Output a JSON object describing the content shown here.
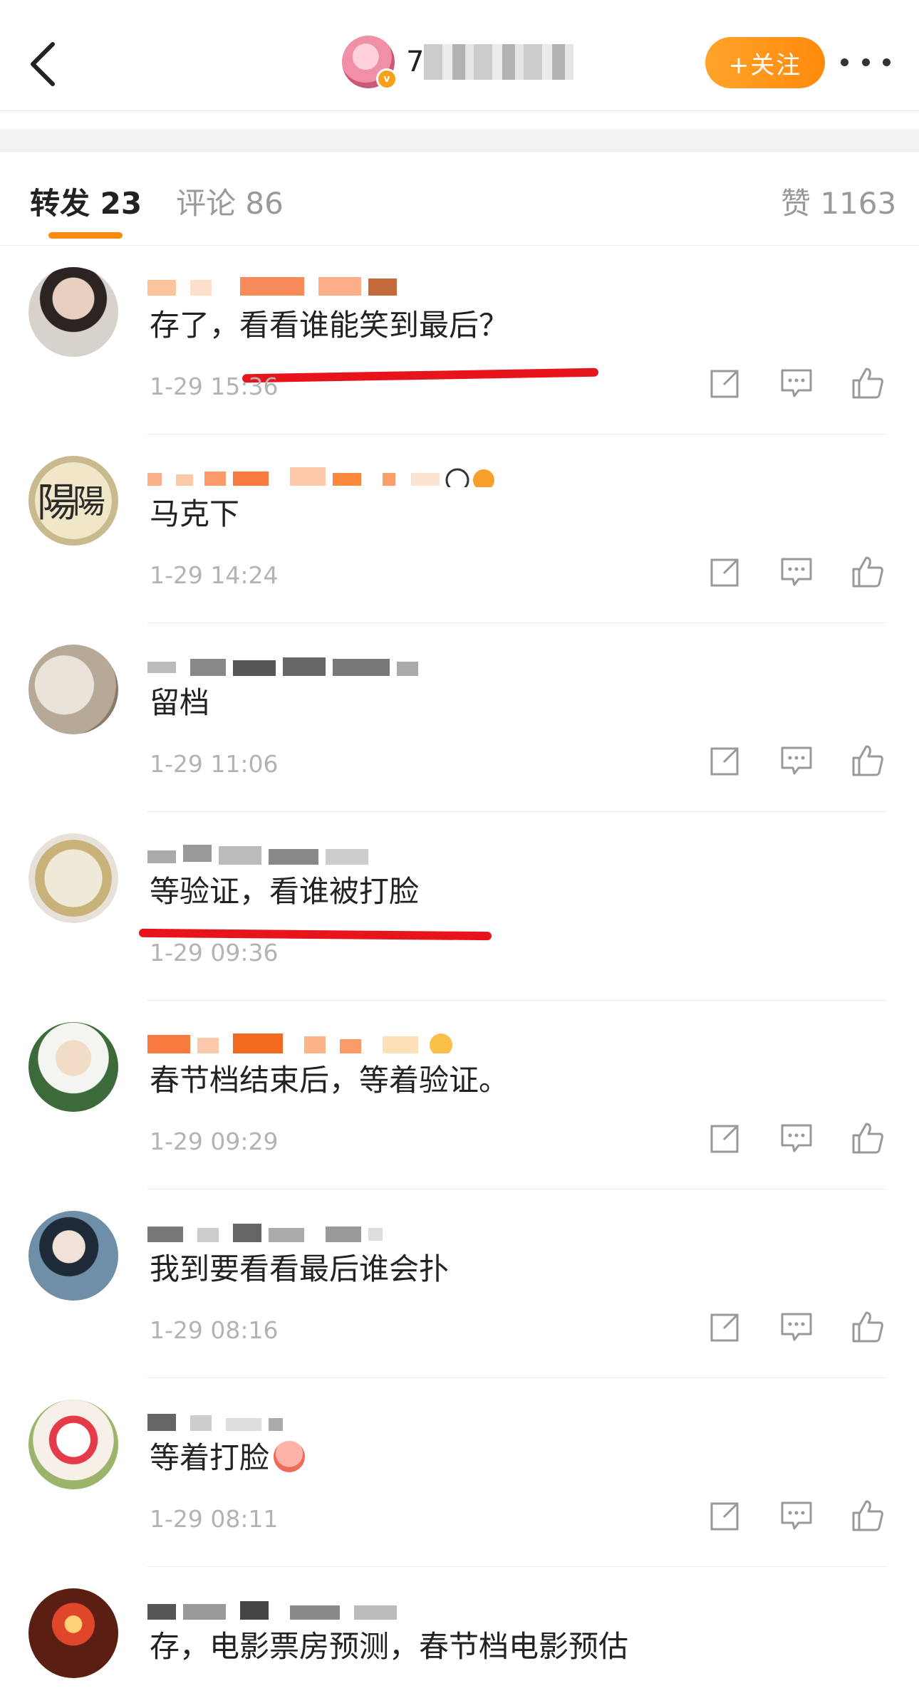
{
  "header": {
    "back_label": "",
    "name": "7",
    "follow_label": "+关注"
  },
  "tabs": [
    {
      "label": "转发 23"
    },
    {
      "label": "评论 86"
    },
    {
      "label": "赞 1163"
    }
  ],
  "comments": [
    {
      "text": "存了，看看谁能笑到最后？",
      "time": "1-29 15:36"
    },
    {
      "text": "马克下",
      "time": "1-29 14:24"
    },
    {
      "text": "留档",
      "time": "1-29 11:06"
    },
    {
      "text": "等验证，看谁被打脸",
      "time": "1-29 09:36"
    },
    {
      "text": "春节档结束后，等着验证。",
      "time": "1-29 09:29"
    },
    {
      "text": "我到要看看最后谁会扑",
      "time": "1-29 08:16"
    },
    {
      "text": "等着打脸",
      "time": "1-29 08:11"
    },
    {
      "text": "存，电影票房预测，春节档电影预估",
      "time": ""
    }
  ],
  "colors": {
    "accent": "#ff8a0c",
    "annotation_red": "#e8141c",
    "muted": "#b3b3b3"
  },
  "icons": [
    "back-chevron-icon",
    "more-dots-icon",
    "share-icon",
    "comment-icon",
    "like-icon"
  ]
}
